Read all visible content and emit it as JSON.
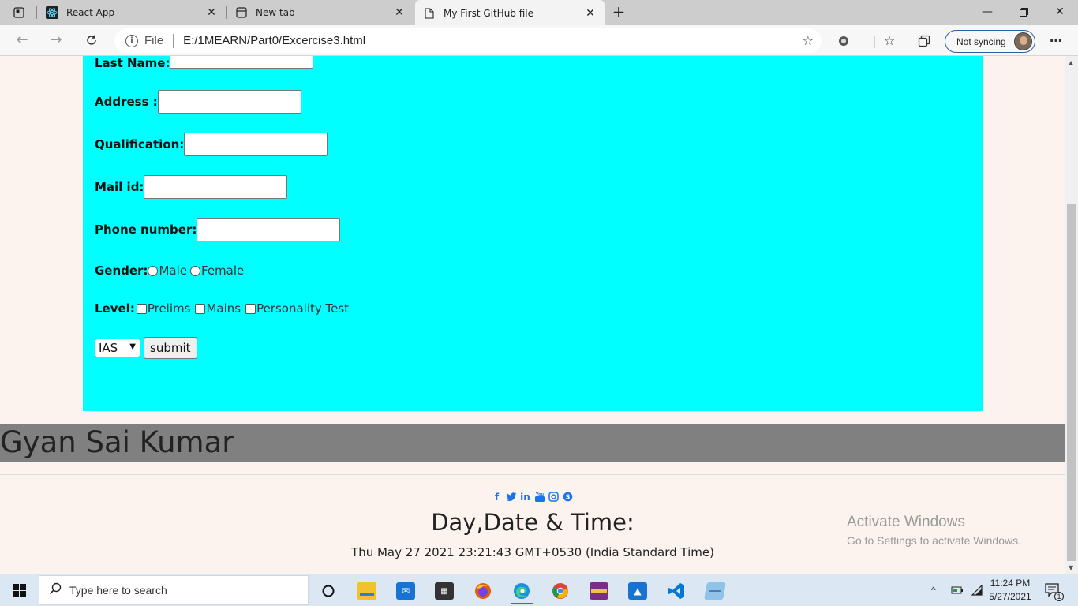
{
  "browser": {
    "tabs": [
      {
        "title": "React App",
        "icon": "react-icon"
      },
      {
        "title": "New tab",
        "icon": "newtab-icon"
      },
      {
        "title": "My First GitHub file",
        "icon": "file-icon",
        "active": true
      }
    ],
    "address": {
      "scheme": "File",
      "url": "E:/1MEARN/Part0/Excercise3.html"
    },
    "profile": {
      "status": "Not syncing"
    }
  },
  "form": {
    "last_name_label": "Last Name:",
    "address_label": "Address :",
    "qualification_label": "Qualification:",
    "mail_label": "Mail id:",
    "phone_label": "Phone number:",
    "gender_label": "Gender:",
    "gender_options": [
      "Male",
      "Female"
    ],
    "level_label": "Level:",
    "level_options": [
      "Prelims",
      "Mains",
      "Personality Test"
    ],
    "select_value": "IAS",
    "submit_label": "submit",
    "background": "#00ffff"
  },
  "footer": {
    "name": "Gyan Sai Kumar",
    "social_icons": [
      "facebook-icon",
      "twitter-icon",
      "linkedin-icon",
      "youtube-icon",
      "instagram-icon",
      "skype-icon"
    ],
    "datetime_title": "Day,Date & Time:",
    "datetime_value": "Thu May 27 2021 23:21:43 GMT+0530 (India Standard Time)"
  },
  "watermark": {
    "line1": "Activate Windows",
    "line2": "Go to Settings to activate Windows."
  },
  "taskbar": {
    "search_placeholder": "Type here to search",
    "time": "11:24 PM",
    "date": "5/27/2021",
    "notifications": "1"
  },
  "colors": {
    "page_bg": "#fdf3ee",
    "name_bar": "#808080",
    "accent": "#1a73e8"
  }
}
